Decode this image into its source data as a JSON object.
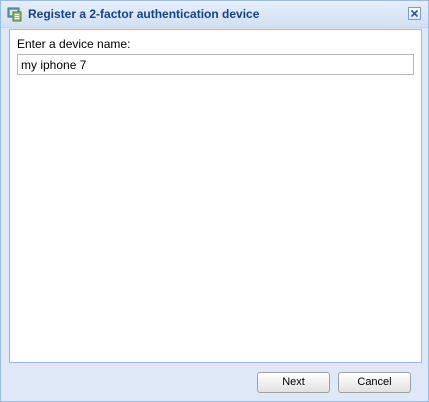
{
  "dialog": {
    "title": "Register a 2-factor authentication device",
    "icon": "device-register-icon",
    "close_icon": "close-icon"
  },
  "form": {
    "device_name_label": "Enter a device name:",
    "device_name_value": "my iphone 7"
  },
  "buttons": {
    "next_label": "Next",
    "cancel_label": "Cancel"
  },
  "colors": {
    "title_text": "#15428b",
    "panel_border": "#99bbe8",
    "dialog_background": "#dfe8f6"
  }
}
